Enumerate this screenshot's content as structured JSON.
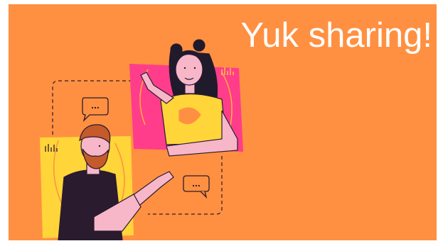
{
  "slide": {
    "headline": "Yuk sharing!"
  },
  "illustration": {
    "chat_bubble_top": "...",
    "chat_bubble_bottom": "..."
  },
  "colors": {
    "background": "#FF9041",
    "panel_pink": "#FF3D8B",
    "panel_yellow": "#FFD53A",
    "outline": "#2A1B2E",
    "skin": "#F7B7C9",
    "hair_woman": "#1F1A2C",
    "hair_man": "#C55A2B",
    "shirt_woman": "#FFD53A",
    "shirt_man": "#2A1B2E"
  }
}
